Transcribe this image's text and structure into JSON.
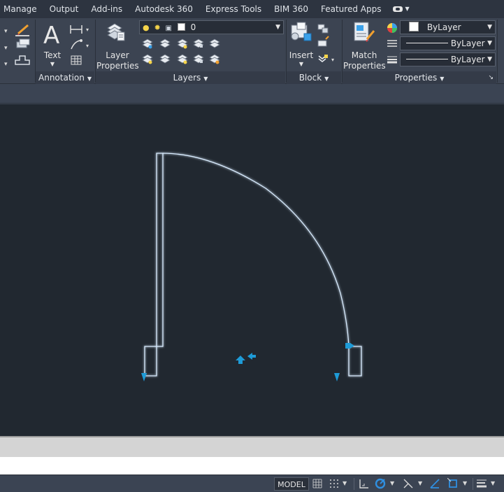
{
  "menu": {
    "tabs": [
      "Manage",
      "Output",
      "Add-ins",
      "Autodesk 360",
      "Express Tools",
      "BIM 360",
      "Featured Apps"
    ]
  },
  "ribbon": {
    "annotation": {
      "panel_label": "Annotation",
      "text_label": "Text"
    },
    "layers": {
      "panel_label": "Layers",
      "layer_properties_label1": "Layer",
      "layer_properties_label2": "Properties",
      "current_layer": "0"
    },
    "block": {
      "panel_label": "Block",
      "insert_label": "Insert"
    },
    "properties": {
      "panel_label": "Properties",
      "match_label1": "Match",
      "match_label2": "Properties",
      "color_value": "ByLayer",
      "linetype_value": "ByLayer",
      "lineweight_value": "ByLayer"
    }
  },
  "status": {
    "model_label": "MODEL"
  },
  "colors": {
    "canvas": "#212830",
    "ribbon": "#3c4452",
    "selection_outline": "#cfe6ff",
    "grip_blue": "#1e9bd7"
  }
}
